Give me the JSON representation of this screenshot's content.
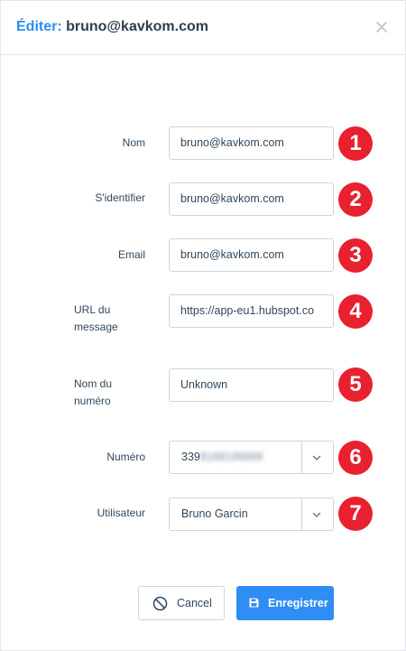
{
  "modal": {
    "title_prefix": "Éditer:",
    "title_subject": "bruno@kavkom.com"
  },
  "form": {
    "nom": {
      "label": "Nom",
      "value": "bruno@kavkom.com",
      "badge": "1"
    },
    "identifier": {
      "label": "S'identifier",
      "value": "bruno@kavkom.com",
      "badge": "2"
    },
    "email": {
      "label": "Email",
      "value": "bruno@kavkom.com",
      "badge": "3"
    },
    "url": {
      "label_line1": "URL du",
      "label_line2": "message",
      "value": "https://app-eu1.hubspot.co",
      "badge": "4"
    },
    "nom_numero": {
      "label_line1": "Nom du",
      "label_line2": "numéro",
      "value": "Unknown",
      "badge": "5"
    },
    "numero": {
      "label": "Numéro",
      "value_visible": "339",
      "value_blurred": "8168199999",
      "badge": "6"
    },
    "utilisateur": {
      "label": "Utilisateur",
      "value": "Bruno Garcin",
      "badge": "7"
    }
  },
  "actions": {
    "cancel_label": "Cancel",
    "save_label": "Enregistrer"
  },
  "colors": {
    "accent": "#2e8ef3",
    "badge": "#e8202f",
    "text": "#33475b",
    "border": "#cbd6e2"
  },
  "icons": {
    "close": "close-icon",
    "cancel": "ban-icon",
    "save": "save-icon",
    "dropdown": "chevron-down-icon"
  }
}
